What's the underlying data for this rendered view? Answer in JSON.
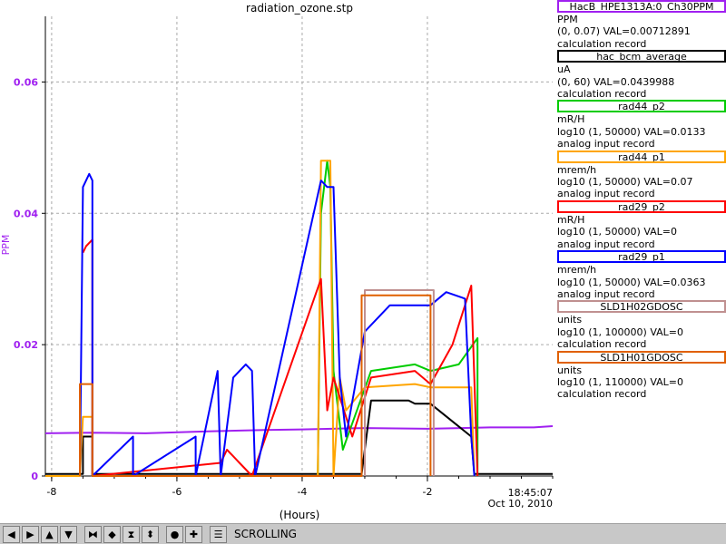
{
  "window_title": "radiation_ozone.stp",
  "chart_data": {
    "type": "line",
    "title": "radiation_ozone.stp",
    "xlabel": "(Hours)",
    "ylabel": "PPM",
    "xlim": [
      -8.1,
      0
    ],
    "ylim": [
      0,
      0.07
    ],
    "x_ticks": [
      -8,
      -6,
      -4,
      -2
    ],
    "x_tick_labels": [
      "-8",
      "-6",
      "-4",
      "-2"
    ],
    "y_ticks": [
      0,
      0.02,
      0.04,
      0.06
    ],
    "y_tick_labels": [
      "0",
      "0.02",
      "0.04",
      "0.06"
    ],
    "end_time_label": "18:45:07",
    "end_date_label": "Oct 10, 2010",
    "grid": true,
    "legend_placement": "right",
    "series": [
      {
        "name": "HacB_HPE1313A:0_Ch30PPM",
        "color": "#a020f0",
        "x": [
          -8.1,
          -7.4,
          -6.5,
          -5.5,
          -4.6,
          -4.0,
          -3.0,
          -2.0,
          -1.0,
          -0.3,
          0
        ],
        "values": [
          0.0065,
          0.0066,
          0.0065,
          0.0068,
          0.007,
          0.0071,
          0.0073,
          0.0072,
          0.0074,
          0.0074,
          0.0076
        ]
      },
      {
        "name": "hac_bcm_average",
        "color": "#000000",
        "x": [
          -8.1,
          -7.5,
          -7.5,
          -7.35,
          -7.35,
          -3.05,
          -2.9,
          -2.3,
          -2.2,
          -1.95,
          -1.3,
          -1.25,
          -0.5,
          0
        ],
        "values": [
          0.0003,
          0.0003,
          0.006,
          0.006,
          0.0003,
          0.0003,
          0.0115,
          0.0115,
          0.011,
          0.011,
          0.006,
          0.0003,
          0.0003,
          0.0003
        ]
      },
      {
        "name": "rad44_p2",
        "color": "#00cc00",
        "x": [
          -3.75,
          -3.7,
          -3.6,
          -3.55,
          -3.5,
          -3.35,
          -2.9,
          -2.2,
          -1.95,
          -1.5,
          -1.2,
          -1.2
        ],
        "values": [
          0.0,
          0.04,
          0.048,
          0.044,
          0.016,
          0.004,
          0.016,
          0.017,
          0.016,
          0.017,
          0.021,
          0.0
        ]
      },
      {
        "name": "rad44_p1",
        "color": "#ffa500",
        "x": [
          -8.1,
          -7.55,
          -7.5,
          -7.35,
          -7.35,
          -3.75,
          -3.7,
          -3.6,
          -3.55,
          -3.5,
          -3.4,
          -3.3,
          -3.0,
          -2.2,
          -1.95,
          -1.5,
          -1.3,
          -1.25
        ],
        "values": [
          0.0,
          0.0,
          0.009,
          0.009,
          0.0,
          0.0,
          0.048,
          0.048,
          0.048,
          0.0,
          0.015,
          0.01,
          0.0135,
          0.014,
          0.0135,
          0.0135,
          0.0135,
          0.0
        ]
      },
      {
        "name": "rad29_p2",
        "color": "#ff0000",
        "x": [
          -7.5,
          -7.45,
          -7.35,
          -7.35,
          -5.3,
          -5.2,
          -5.0,
          -4.8,
          -3.7,
          -3.6,
          -3.5,
          -3.2,
          -2.9,
          -2.2,
          -1.95,
          -1.6,
          -1.3,
          -1.2
        ],
        "values": [
          0.034,
          0.035,
          0.036,
          0.0,
          0.002,
          0.004,
          0.002,
          0.0,
          0.03,
          0.01,
          0.015,
          0.006,
          0.015,
          0.016,
          0.014,
          0.02,
          0.029,
          0.0
        ]
      },
      {
        "name": "rad29_p1",
        "color": "#0000ff",
        "x": [
          -7.55,
          -7.5,
          -7.4,
          -7.35,
          -7.35,
          -6.7,
          -6.7,
          -5.7,
          -5.7,
          -5.35,
          -5.3,
          -5.1,
          -4.9,
          -4.8,
          -4.75,
          -3.7,
          -3.6,
          -3.5,
          -3.4,
          -3.3,
          -3.0,
          -2.6,
          -2.2,
          -1.95,
          -1.7,
          -1.4,
          -1.3,
          -1.25
        ],
        "values": [
          0.0,
          0.044,
          0.046,
          0.045,
          0.0,
          0.006,
          0.0,
          0.006,
          0.0,
          0.016,
          0.0,
          0.015,
          0.017,
          0.016,
          0.0,
          0.045,
          0.044,
          0.044,
          0.015,
          0.006,
          0.022,
          0.026,
          0.026,
          0.026,
          0.028,
          0.027,
          0.006,
          0.0
        ]
      },
      {
        "name": "SLD1H02GDOSC",
        "color": "#c09090",
        "x": [
          -3.0,
          -3.0,
          -1.9,
          -1.9
        ],
        "values": [
          0.0,
          0.0283,
          0.0283,
          0.0
        ]
      },
      {
        "name": "SLD1H01GDOSC",
        "color": "#e06000",
        "x": [
          -7.55,
          -7.55,
          -7.35,
          -7.35,
          -3.05,
          -3.05,
          -1.95,
          -1.95
        ],
        "values": [
          0.0,
          0.014,
          0.014,
          0.0,
          0.0,
          0.0275,
          0.0275,
          0.0
        ]
      }
    ]
  },
  "legend": [
    {
      "name": "HacB_HPE1313A:0_Ch30PPM",
      "color": "#a020f0",
      "units": "PPM",
      "range": "(0, 0.07) VAL=0.00712891",
      "record": "calculation record"
    },
    {
      "name": "hac_bcm_average",
      "color": "#000000",
      "units": "uA",
      "range": "(0, 60) VAL=0.0439988",
      "record": "calculation record"
    },
    {
      "name": "rad44_p2",
      "color": "#00cc00",
      "units": "mR/H",
      "range": "log10 (1, 50000) VAL=0.0133",
      "record": "analog input record"
    },
    {
      "name": "rad44_p1",
      "color": "#ffa500",
      "units": "mrem/h",
      "range": "log10 (1, 50000) VAL=0.07",
      "record": "analog input record"
    },
    {
      "name": "rad29_p2",
      "color": "#ff0000",
      "units": "mR/H",
      "range": "log10 (1, 50000) VAL=0",
      "record": "analog input record"
    },
    {
      "name": "rad29_p1",
      "color": "#0000ff",
      "units": "mrem/h",
      "range": "log10 (1, 50000) VAL=0.0363",
      "record": "analog input record"
    },
    {
      "name": "SLD1H02GDOSC",
      "color": "#c09090",
      "units": "units",
      "range": "log10 (1, 100000) VAL=0",
      "record": "calculation record"
    },
    {
      "name": "SLD1H01GDOSC",
      "color": "#e06000",
      "units": "units",
      "range": "log10 (1, 110000) VAL=0",
      "record": "calculation record"
    }
  ],
  "toolbar": {
    "buttons": [
      {
        "name": "pan-left-button",
        "icon": "arrow-left-icon",
        "glyph": "◀"
      },
      {
        "name": "pan-right-button",
        "icon": "arrow-right-icon",
        "glyph": "▶"
      },
      {
        "name": "pan-up-button",
        "icon": "arrow-up-icon",
        "glyph": "▲"
      },
      {
        "name": "pan-down-button",
        "icon": "arrow-down-icon",
        "glyph": "▼"
      },
      {
        "name": "zoom-in-x-button",
        "icon": "zoom-in-x-icon",
        "glyph": "⧓"
      },
      {
        "name": "zoom-out-x-button",
        "icon": "zoom-out-x-icon",
        "glyph": "◆"
      },
      {
        "name": "zoom-in-y-button",
        "icon": "zoom-in-y-icon",
        "glyph": "⧗"
      },
      {
        "name": "zoom-out-y-button",
        "icon": "zoom-out-y-icon",
        "glyph": "⬍"
      },
      {
        "name": "auto-scale-button",
        "icon": "circle-icon",
        "glyph": "●"
      },
      {
        "name": "cursor-button",
        "icon": "crosshair-icon",
        "glyph": "✚"
      },
      {
        "name": "config-button",
        "icon": "config-icon",
        "glyph": "☰"
      }
    ],
    "status": "SCROLLING"
  }
}
